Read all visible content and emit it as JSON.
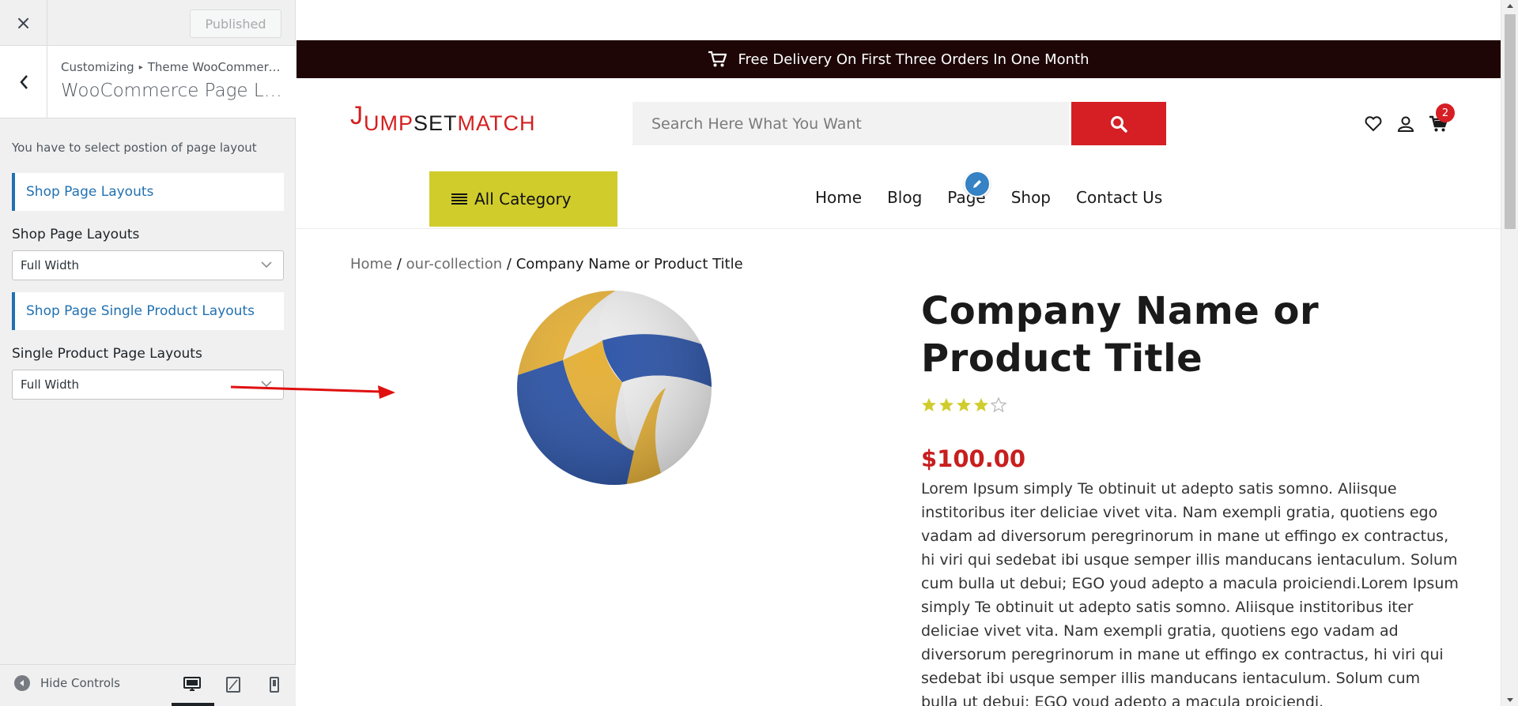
{
  "customizer": {
    "close_icon": "×",
    "publish_label": "Published",
    "breadcrumb_root": "Customizing",
    "breadcrumb_sep": "▸",
    "breadcrumb_parent": "Theme WooCommerce Settings",
    "section_title": "WooCommerce Page Layouts",
    "description": "You have to select postion of page layout",
    "shop_heading": "Shop Page Layouts",
    "shop_label": "Shop Page Layouts",
    "shop_value": "Full Width",
    "single_heading": "Shop Page Single Product Layouts",
    "single_label": "Single Product Page Layouts",
    "single_value": "Full Width",
    "hide_controls": "Hide Controls",
    "devices": [
      "desktop-icon",
      "tablet-icon",
      "mobile-icon"
    ],
    "accent_color": "#2271b1"
  },
  "site": {
    "announcement": "Free Delivery On First Three Orders In One Month",
    "logo": {
      "j": "J",
      "ump": "UMP",
      "set": "SET",
      "match": "MATCH"
    },
    "search_placeholder": "Search Here What You Want",
    "cart_count": "2",
    "all_category": "All Category",
    "nav": [
      "Home",
      "Blog",
      "Page",
      "Shop",
      "Contact Us"
    ],
    "breadcrumb": {
      "home": "Home",
      "sep": " / ",
      "collection": "our-collection",
      "current": "Company Name or Product Title"
    },
    "product": {
      "title": "Company Name or Product Title",
      "rating": 4,
      "rating_max": 5,
      "price": "$100.00",
      "description": "Lorem Ipsum simply Te obtinuit ut adepto satis somno. Aliisque institoribus iter deliciae vivet vita. Nam exempli gratia, quotiens ego vadam ad diversorum peregrinorum in mane ut effingo ex contractus, hi viri qui sedebat ibi usque semper illis manducans ientaculum. Solum cum bulla ut debui; EGO youd adepto a macula proiciendi.Lorem Ipsum simply Te obtinuit ut adepto satis somno. Aliisque institoribus iter deliciae vivet vita. Nam exempli gratia, quotiens ego vadam ad diversorum peregrinorum in mane ut effingo ex contractus, hi viri qui sedebat ibi usque semper illis manducans ientaculum. Solum cum bulla ut debui; EGO youd adepto a macula proiciendi."
    },
    "colors": {
      "topbar": "#1e0606",
      "brand_red": "#d51f25",
      "category_yellow": "#d0cc2c"
    }
  }
}
